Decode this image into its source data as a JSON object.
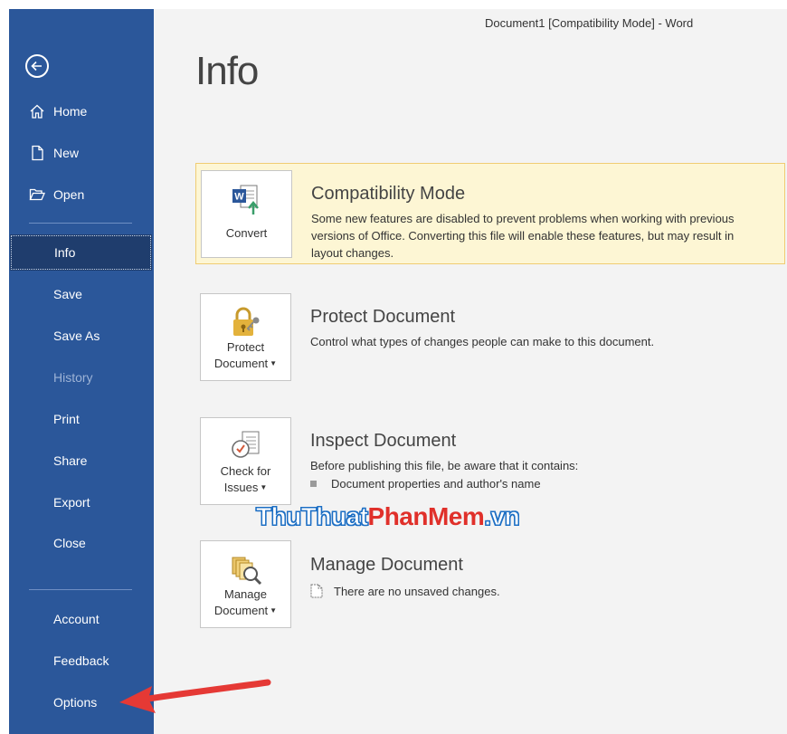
{
  "window": {
    "title": "Document1 [Compatibility Mode]  -  Word"
  },
  "sidebar": {
    "top_items": [
      {
        "label": "Home",
        "icon": "home-icon"
      },
      {
        "label": "New",
        "icon": "new-document-icon"
      },
      {
        "label": "Open",
        "icon": "folder-open-icon"
      }
    ],
    "mid_items": [
      {
        "label": "Info",
        "state": "active"
      },
      {
        "label": "Save"
      },
      {
        "label": "Save As"
      },
      {
        "label": "History",
        "state": "disabled"
      },
      {
        "label": "Print"
      },
      {
        "label": "Share"
      },
      {
        "label": "Export"
      },
      {
        "label": "Close"
      }
    ],
    "bottom_items": [
      {
        "label": "Account"
      },
      {
        "label": "Feedback"
      },
      {
        "label": "Options"
      }
    ]
  },
  "main": {
    "title": "Info",
    "sections": {
      "compatibility": {
        "button_label": "Convert",
        "title": "Compatibility Mode",
        "desc_lines": [
          "Some new features are disabled to prevent problems when working with previous",
          "versions of Office. Converting this file will enable these features, but may result in",
          "layout changes."
        ]
      },
      "protect": {
        "button_line1": "Protect",
        "button_line2": "Document",
        "title": "Protect Document",
        "desc": "Control what types of changes people can make to this document."
      },
      "inspect": {
        "button_line1": "Check for",
        "button_line2": "Issues",
        "title": "Inspect Document",
        "desc": "Before publishing this file, be aware that it contains:",
        "bullet": "Document properties and author's name"
      },
      "manage": {
        "button_line1": "Manage",
        "button_line2": "Document",
        "title": "Manage Document",
        "status": "There are no unsaved changes."
      }
    }
  },
  "watermark": {
    "part1": "ThuThuat",
    "part2": "PhanMem",
    "part3": ".vn"
  },
  "colors": {
    "sidebar": "#2b579a",
    "active_item": "#1f3d6d",
    "warning_bg": "#fdf6d4",
    "warning_border": "#f0cc72",
    "arrow": "#e53935"
  }
}
